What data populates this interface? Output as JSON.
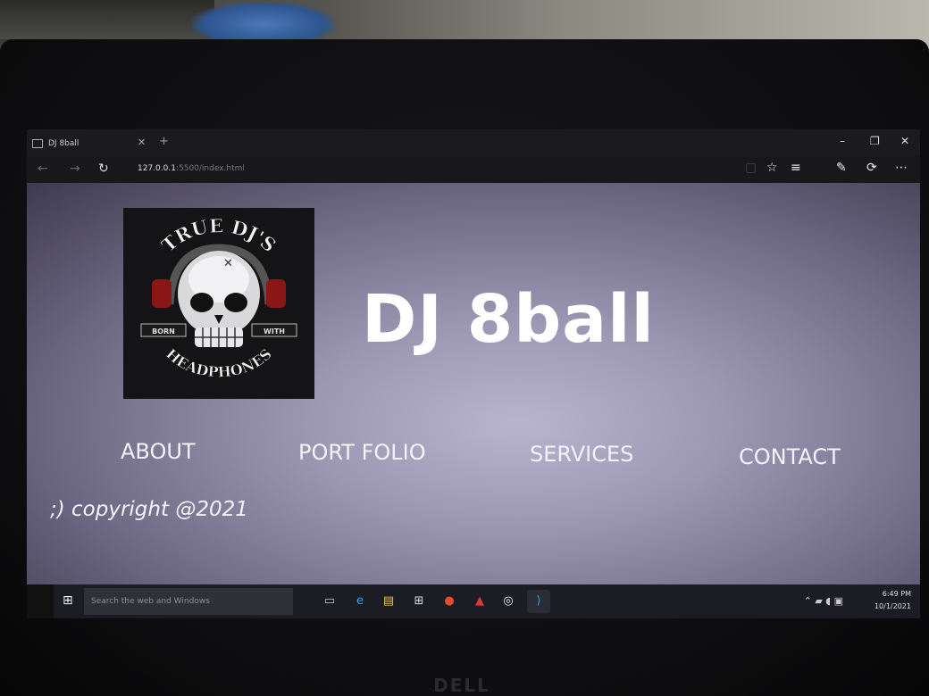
{
  "browser": {
    "tab_title": "DJ 8ball",
    "url_host": "127.0.0.1",
    "url_path": ":5500/index.html"
  },
  "site": {
    "logo": {
      "top_text": "TRUE DJ'S",
      "left_text": "BORN",
      "right_text": "WITH",
      "bottom_text": "HEADPHONES"
    },
    "title": "DJ 8ball",
    "nav": [
      {
        "label": "ABOUT"
      },
      {
        "label": "PORT FOLIO"
      },
      {
        "label": "SERVICES"
      },
      {
        "label": "CONTACT"
      }
    ],
    "copyright": ";) copyright @2021"
  },
  "taskbar": {
    "search_placeholder": "Search the web and Windows",
    "time": "6:49 PM",
    "date": "10/1/2021"
  },
  "device": {
    "brand": "DELL"
  }
}
